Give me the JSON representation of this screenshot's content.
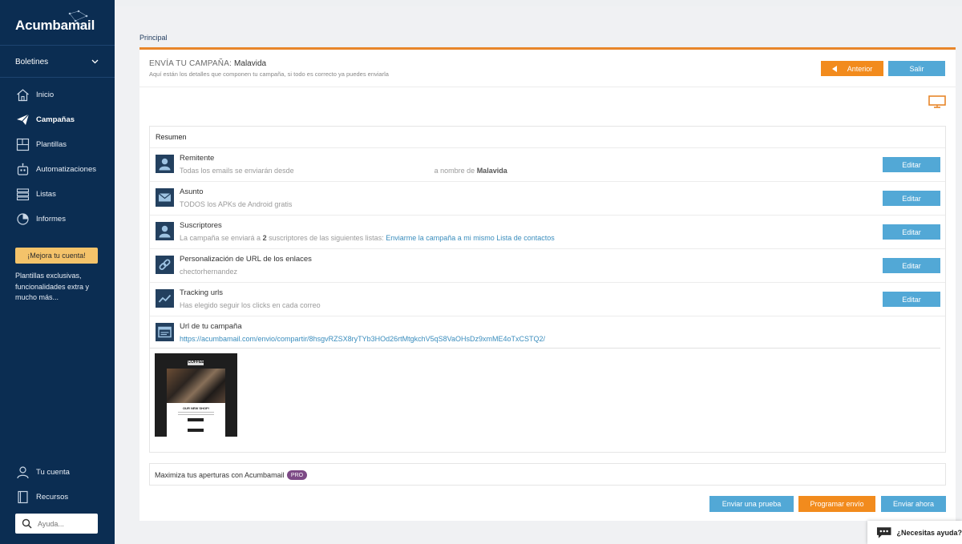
{
  "sidebar": {
    "logo": "Acumbamail",
    "section": "Boletines",
    "nav": [
      {
        "label": "Inicio",
        "icon": "home-icon"
      },
      {
        "label": "Campañas",
        "icon": "paper-plane-icon"
      },
      {
        "label": "Plantillas",
        "icon": "template-icon"
      },
      {
        "label": "Automatizaciones",
        "icon": "robot-icon"
      },
      {
        "label": "Listas",
        "icon": "list-icon"
      },
      {
        "label": "Informes",
        "icon": "reports-icon"
      }
    ],
    "upgrade_label": "¡Mejora tu cuenta!",
    "upgrade_text": "Plantillas exclusivas, funcionalidades extra y mucho más...",
    "account": "Tu cuenta",
    "resources": "Recursos",
    "search_placeholder": "Ayuda..."
  },
  "tabs": {
    "principal": "Principal"
  },
  "header": {
    "title_prefix": "ENVÍA TU CAMPAÑA:",
    "campaign_name": "Malavida",
    "subtitle": "Aquí están los detalles que componen tu campaña, si todo es correcto ya puedes enviarla",
    "anterior": "Anterior",
    "salir": "Salir"
  },
  "resumen": {
    "title": "Resumen",
    "edit_label": "Editar",
    "remitente": {
      "title": "Remitente",
      "desc_start": "Todas los emails se enviarán desde",
      "desc_mid": "a nombre de",
      "sender_name": "Malavida"
    },
    "asunto": {
      "title": "Asunto",
      "desc": "TODOS los APKs de Android gratis"
    },
    "suscriptores": {
      "title": "Suscriptores",
      "desc_start": "La campaña se enviará a",
      "count": "2",
      "desc_end": "suscriptores de las siguientes listas:",
      "lists": "Enviarme la campaña a mi mismo Lista de contactos"
    },
    "personalizacion": {
      "title": "Personalización de URL de los enlaces",
      "desc": "chectorhernandez"
    },
    "tracking": {
      "title": "Tracking urls",
      "desc": "Has elegido seguir los clicks en cada correo"
    },
    "url": {
      "title": "Url de tu campaña",
      "link": "https://acumbamail.com/envio/compartir/8hsgvRZSX8ryTYb3HOd26rtMtgkchV5qS8VaOHsDz9xmME4oTxCSTQ2/"
    },
    "thumbnail": {
      "brand": "COFFEE",
      "heading": "OUR NEW SHOP!"
    }
  },
  "maximiza": {
    "text": "Maximiza tus aperturas con Acumbamail",
    "badge": "PRO"
  },
  "actions": {
    "prueba": "Enviar una prueba",
    "programar": "Programar envío",
    "ahora": "Enviar ahora"
  },
  "chat": {
    "label": "¿Necesitas ayuda?"
  },
  "colors": {
    "sidebar": "#0b2d52",
    "accent_orange": "#f28b1d",
    "accent_blue": "#52a8d6",
    "pro_badge": "#7d4a86"
  }
}
